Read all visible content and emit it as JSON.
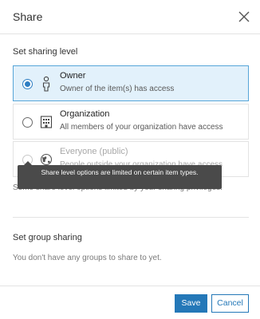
{
  "header": {
    "title": "Share",
    "close_icon": "close-icon"
  },
  "sharing_level": {
    "label": "Set sharing level",
    "options": [
      {
        "title": "Owner",
        "description": "Owner of the item(s) has access",
        "icon": "person-icon",
        "selected": true
      },
      {
        "title": "Organization",
        "description": "All members of your organization have access",
        "icon": "building-icon",
        "selected": false
      },
      {
        "title": "Everyone (public)",
        "description": "People outside your organization have access",
        "icon": "globe-icon",
        "selected": false
      }
    ],
    "note": "Some share level options limited by your sharing privileges."
  },
  "tooltip": {
    "text": "Share level options are limited on certain item types."
  },
  "group_sharing": {
    "label": "Set group sharing",
    "note": "You don't have any groups to share to yet."
  },
  "footer": {
    "save_label": "Save",
    "cancel_label": "Cancel"
  },
  "colors": {
    "accent": "#2478b8",
    "selected_bg": "#e2f1fb",
    "tooltip_bg": "#4a4a4a"
  }
}
